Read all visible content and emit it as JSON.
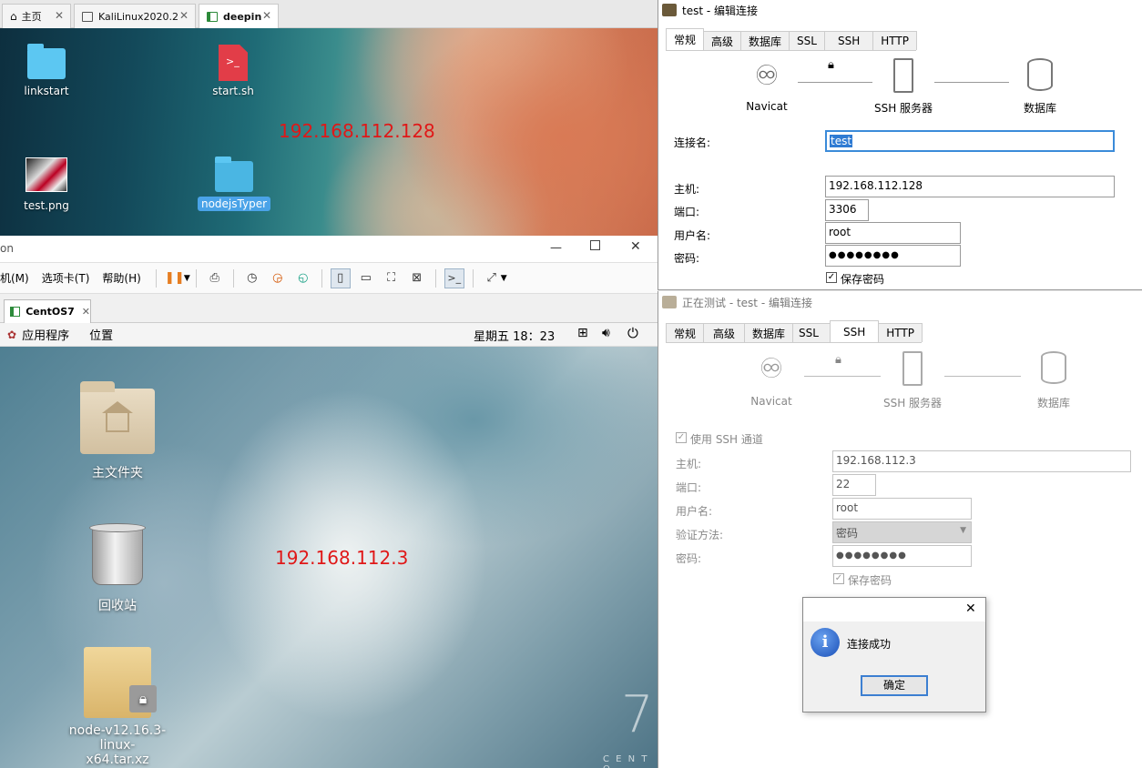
{
  "vm_tabs": [
    {
      "label": "主页",
      "icon": "home-icon"
    },
    {
      "label": "KaliLinux2020.2",
      "icon": "vm-icon"
    },
    {
      "label": "deepin",
      "icon": "vm-running-icon"
    }
  ],
  "deepin": {
    "icons": [
      {
        "label": "linkstart",
        "type": "folder-icon"
      },
      {
        "label": "start.sh",
        "type": "shell-script-icon"
      },
      {
        "label": "test.png",
        "type": "image-thumbnail-icon"
      },
      {
        "label": "nodejsTyper",
        "type": "folder-icon"
      }
    ],
    "ip_annotation": "192.168.112.128"
  },
  "vmware": {
    "title_fragment": "on",
    "menu": [
      "机(M)",
      "选项卡(T)",
      "帮助(H)"
    ],
    "vm_tab": "CentOS7",
    "centos_topbar": {
      "apps": "应用程序",
      "places": "位置",
      "clock": "星期五 18：23"
    },
    "centos_icons": [
      {
        "label": "主文件夹",
        "type": "home-folder-icon"
      },
      {
        "label": "回收站",
        "type": "trash-icon"
      },
      {
        "label": "node-v12.16.3-linux-x64.tar.xz",
        "line1": "node-v12.16.3-linux-",
        "line2": "x64.tar.xz",
        "type": "archive-locked-icon"
      }
    ],
    "ip_annotation": "192.168.112.3",
    "watermark_7": "7",
    "watermark_text": "C E N T O"
  },
  "navicat_general": {
    "title": "test - 编辑连接",
    "tabs": [
      "常规",
      "高级",
      "数据库",
      "SSL",
      "SSH",
      "HTTP"
    ],
    "active_tab": "常规",
    "diagram": {
      "left": "Navicat",
      "middle": "SSH 服务器",
      "right": "数据库"
    },
    "fields": {
      "conn_name_label": "连接名:",
      "conn_name": "test",
      "host_label": "主机:",
      "host": "192.168.112.128",
      "port_label": "端口:",
      "port": "3306",
      "user_label": "用户名:",
      "user": "root",
      "pass_label": "密码:",
      "pass": "●●●●●●●●",
      "save_pass": "保存密码"
    }
  },
  "navicat_ssh": {
    "title": "正在测试 - test - 编辑连接",
    "tabs": [
      "常规",
      "高级",
      "数据库",
      "SSL",
      "SSH",
      "HTTP"
    ],
    "active_tab": "SSH",
    "diagram": {
      "left": "Navicat",
      "middle": "SSH 服务器",
      "right": "数据库"
    },
    "fields": {
      "use_ssh": "使用 SSH 通道",
      "host_label": "主机:",
      "host": "192.168.112.3",
      "port_label": "端口:",
      "port": "22",
      "user_label": "用户名:",
      "user": "root",
      "auth_label": "验证方法:",
      "auth": "密码",
      "pass_label": "密码:",
      "pass": "●●●●●●●●",
      "save_pass": "保存密码"
    }
  },
  "dialog": {
    "message": "连接成功",
    "ok": "确定",
    "close": "✕",
    "icon": "info-icon"
  }
}
